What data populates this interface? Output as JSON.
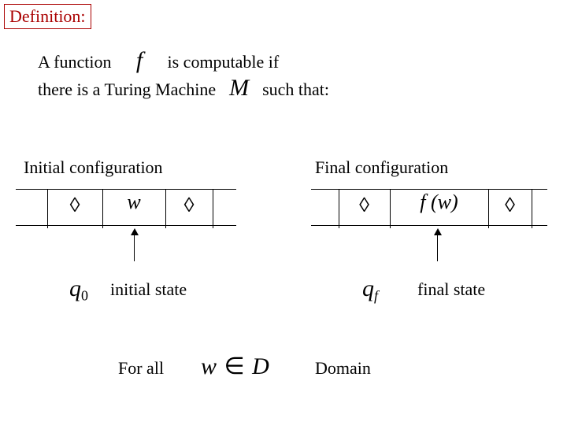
{
  "header": {
    "title": "Definition:"
  },
  "intro": {
    "line1a": "A function",
    "fn": "f",
    "line1b": "is computable if",
    "line2a": "there is a Turing Machine",
    "machine": "M",
    "line2b": "such that:"
  },
  "labels": {
    "initial_conf": "Initial configuration",
    "final_conf": "Final configuration",
    "initial_state": "initial state",
    "final_state": "final state",
    "for_all": "For all",
    "domain": "Domain"
  },
  "tape_left": {
    "c1": "◊",
    "c2": "w",
    "c3": "◊"
  },
  "tape_right": {
    "c1": "◊",
    "c2": "f (w)",
    "c3": "◊"
  },
  "states": {
    "q0_base": "q",
    "q0_sub": "0",
    "qf_base": "q",
    "qf_sub": "f"
  },
  "forall_expr": {
    "w": "w",
    "in": "∈",
    "D": "D"
  }
}
